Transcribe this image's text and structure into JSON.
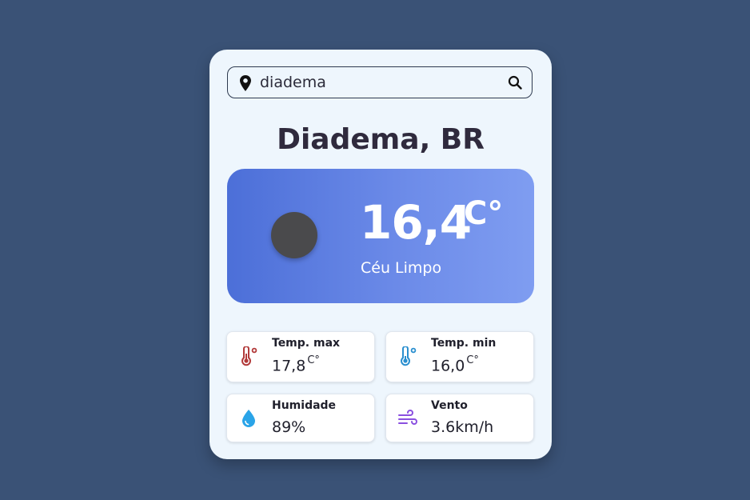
{
  "search": {
    "value": "diadema",
    "placeholder": ""
  },
  "location": {
    "city": "Diadema, BR"
  },
  "current": {
    "temperature": "16,4",
    "unit": "C°",
    "description": "Céu Limpo",
    "condition_icon": "weather-icon"
  },
  "stats": {
    "temp_max": {
      "label": "Temp. max",
      "value": "17,8",
      "unit": "C°",
      "icon": "thermometer-hot-icon"
    },
    "temp_min": {
      "label": "Temp. min",
      "value": "16,0",
      "unit": "C°",
      "icon": "thermometer-cold-icon"
    },
    "humidity": {
      "label": "Humidade",
      "value": "89%",
      "icon": "water-drop-icon"
    },
    "wind": {
      "label": "Vento",
      "value": "3.6km/h",
      "icon": "wind-icon"
    }
  },
  "colors": {
    "background": "#3a5276",
    "card": "#eef6fd",
    "hero_gradient_start": "#4c6fd8",
    "hero_gradient_end": "#7f9df1",
    "temp_max_icon": "#b23a3a",
    "temp_min_icon": "#2b8fcf",
    "humidity_icon": "#2aa4e8",
    "wind_icon": "#8a4fe0"
  }
}
